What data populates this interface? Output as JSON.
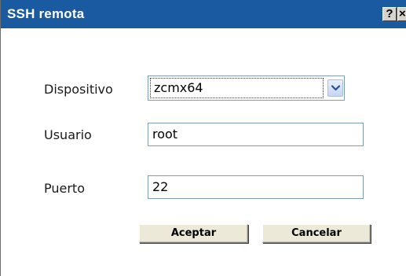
{
  "dialog": {
    "title": "SSH remota",
    "help_label": "?",
    "close_label": "×"
  },
  "form": {
    "device_label": "Dispositivo",
    "device_value": "zcmx64",
    "user_label": "Usuario",
    "user_value": "root",
    "port_label": "Puerto",
    "port_value": "22"
  },
  "buttons": {
    "accept_label": "Aceptar",
    "cancel_label": "Cancelar"
  },
  "colors": {
    "titlebar": "#1a5aa0",
    "field_border": "#7f9db9"
  },
  "icons": {
    "select_arrow": "chevron-down-icon"
  }
}
